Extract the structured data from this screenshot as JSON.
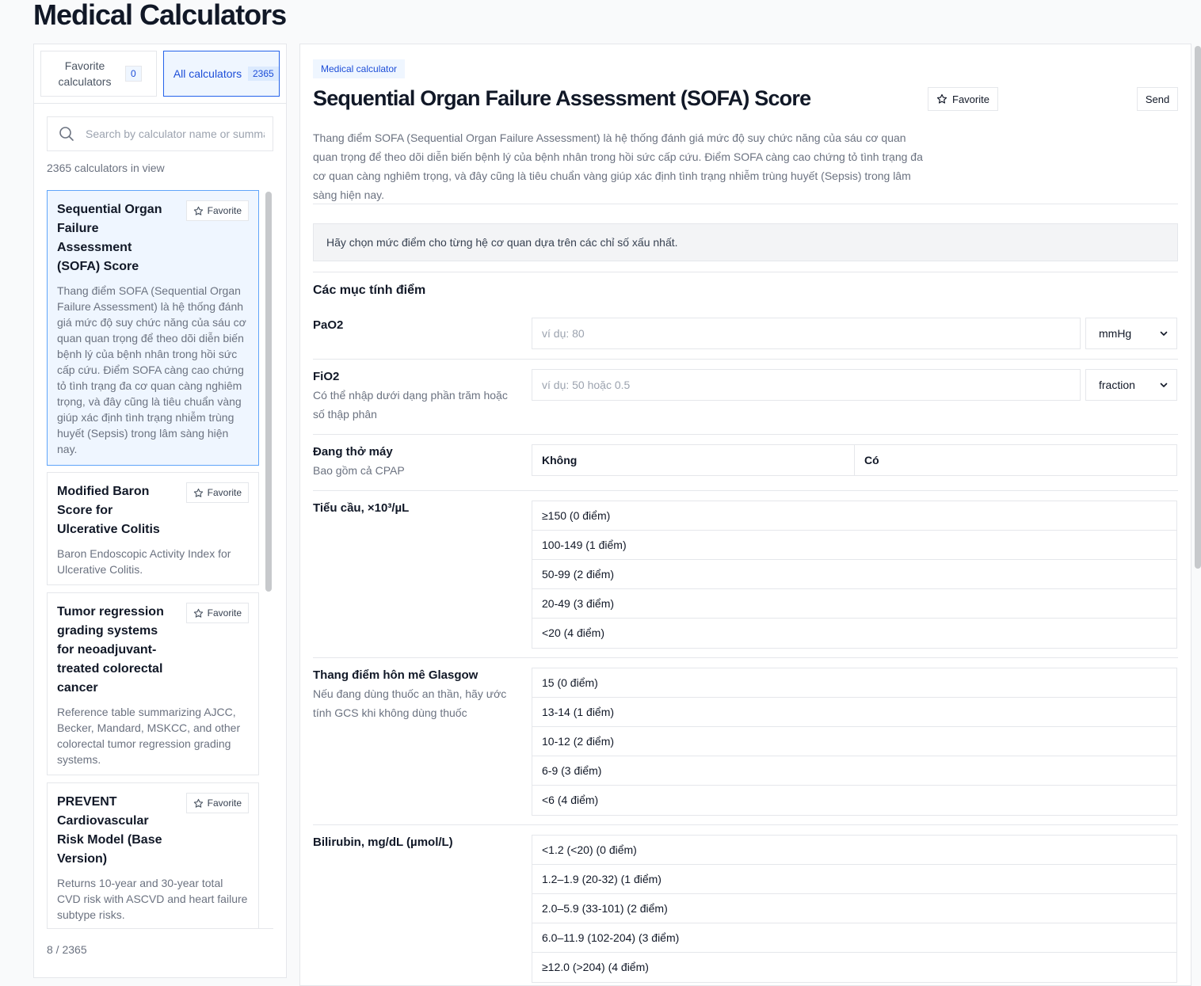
{
  "app": {
    "title": "Medical Calculators"
  },
  "sidebar": {
    "tabs": [
      {
        "label": "Favorite calculators",
        "count": "0"
      },
      {
        "label": "All calculators",
        "count": "2365"
      }
    ],
    "search": {
      "placeholder": "Search by calculator name or summary"
    },
    "in_view_text": "2365 calculators in view",
    "favorite_label": "Favorite",
    "items": [
      {
        "title": "Sequential Organ Failure Assessment (SOFA) Score",
        "desc": "Thang điểm SOFA (Sequential Organ Failure Assessment) là hệ thống đánh giá mức độ suy chức năng của sáu cơ quan quan trọng để theo dõi diễn biến bệnh lý của bệnh nhân trong hồi sức cấp cứu. Điểm SOFA càng cao chứng tỏ tình trạng đa cơ quan càng nghiêm trọng, và đây cũng là tiêu chuẩn vàng giúp xác định tình trạng nhiễm trùng huyết (Sepsis) trong lâm sàng hiện nay.",
        "selected": true
      },
      {
        "title": "Modified Baron Score for Ulcerative Colitis",
        "desc": "Baron Endoscopic Activity Index for Ulcerative Colitis."
      },
      {
        "title": "Tumor regression grading systems for neoadjuvant-treated colorectal cancer",
        "desc": "Reference table summarizing AJCC, Becker, Mandard, MSKCC, and other colorectal tumor regression grading systems."
      },
      {
        "title": "PREVENT Cardiovascular Risk Model (Base Version)",
        "desc": "Returns 10-year and 30-year total CVD risk with ASCVD and heart failure subtype risks."
      }
    ],
    "pager": "8 / 2365"
  },
  "calculator": {
    "badge": "Medical calculator",
    "title": "Sequential Organ Failure Assessment (SOFA) Score",
    "favorite_label": "Favorite",
    "send_label": "Send",
    "description": "Thang điểm SOFA (Sequential Organ Failure Assessment) là hệ thống đánh giá mức độ suy chức năng của sáu cơ quan quan trọng để theo dõi diễn biến bệnh lý của bệnh nhân trong hồi sức cấp cứu. Điểm SOFA càng cao chứng tỏ tình trạng đa cơ quan càng nghiêm trọng, và đây cũng là tiêu chuẩn vàng giúp xác định tình trạng nhiễm trùng huyết (Sepsis) trong lâm sàng hiện nay.",
    "instruction": "Hãy chọn mức điểm cho từng hệ cơ quan dựa trên các chỉ số xấu nhất.",
    "section_title": "Các mục tính điểm",
    "fields": {
      "pao2": {
        "label": "PaO2",
        "placeholder": "ví dụ: 80",
        "unit": "mmHg"
      },
      "fio2": {
        "label": "FiO2",
        "hint": "Có thể nhập dưới dạng phần trăm hoặc số thập phân",
        "placeholder": "ví dụ: 50 hoặc 0.5",
        "unit": "fraction"
      },
      "ventilation": {
        "label": "Đang thở máy",
        "hint": "Bao gồm cả CPAP",
        "options": [
          "Không",
          "Có"
        ]
      },
      "platelets": {
        "label": "Tiểu cầu, ×10³/µL",
        "options": [
          "≥150 (0 điểm)",
          "100-149 (1 điểm)",
          "50-99 (2 điểm)",
          "20-49 (3 điểm)",
          "<20 (4 điểm)"
        ]
      },
      "gcs": {
        "label": "Thang điểm hôn mê Glasgow",
        "hint": "Nếu đang dùng thuốc an thần, hãy ước tính GCS khi không dùng thuốc",
        "options": [
          "15 (0 điểm)",
          "13-14 (1 điểm)",
          "10-12 (2 điểm)",
          "6-9 (3 điểm)",
          "<6 (4 điểm)"
        ]
      },
      "bilirubin": {
        "label": "Bilirubin, mg/dL (µmol/L)",
        "options": [
          "<1.2 (<20) (0 điểm)",
          "1.2–1.9 (20-32) (1 điểm)",
          "2.0–5.9 (33-101) (2 điểm)",
          "6.0–11.9 (102-204) (3 điểm)",
          "≥12.0 (>204) (4 điểm)"
        ]
      }
    }
  }
}
